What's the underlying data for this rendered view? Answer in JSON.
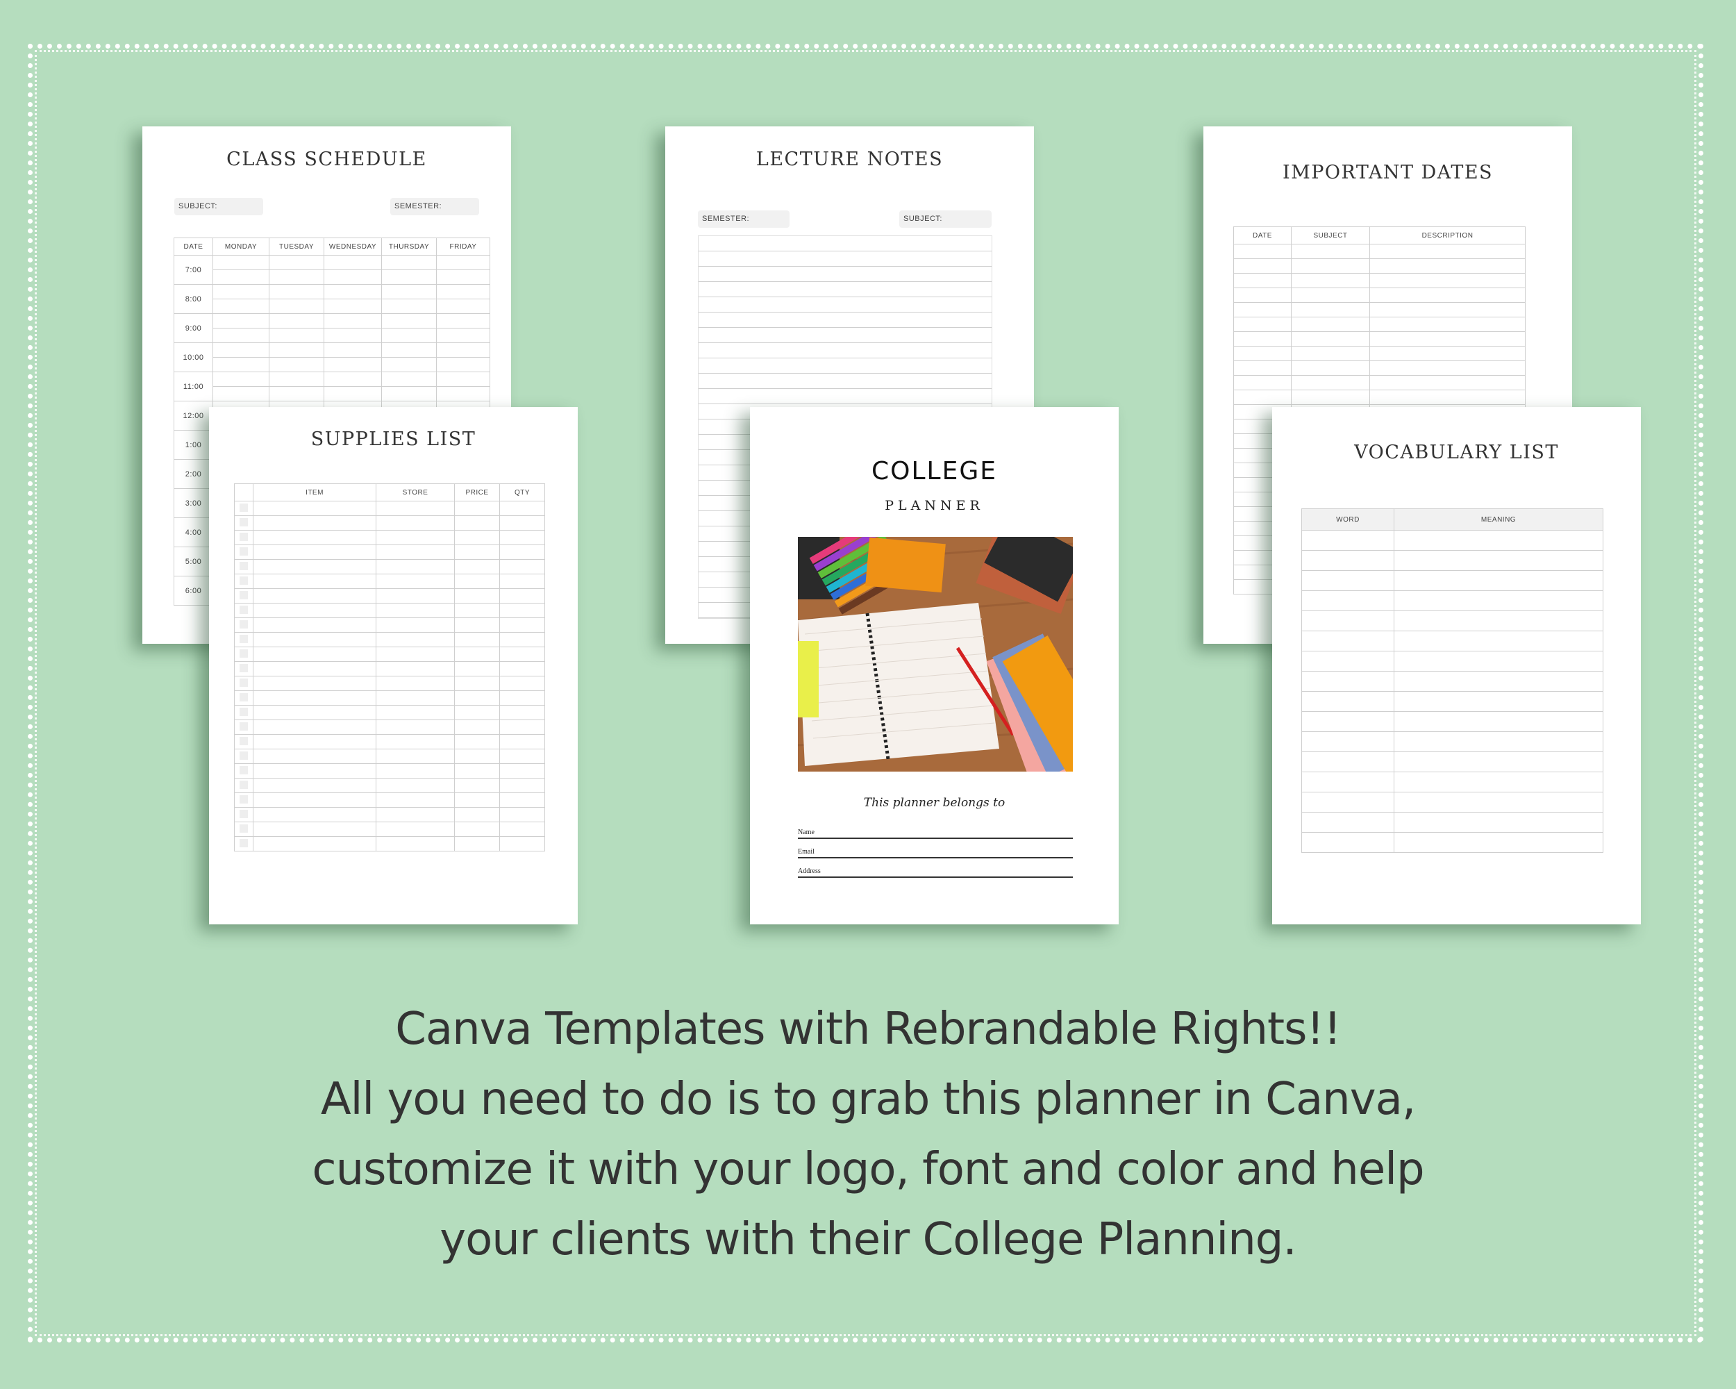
{
  "background_color": "#b5ddbe",
  "pages": {
    "class_schedule": {
      "title": "CLASS SCHEDULE",
      "fields": [
        "SUBJECT:",
        "SEMESTER:"
      ],
      "columns": [
        "DATE",
        "MONDAY",
        "TUESDAY",
        "WEDNESDAY",
        "THURSDAY",
        "FRIDAY"
      ],
      "times": [
        "7:00",
        "8:00",
        "9:00",
        "10:00",
        "11:00",
        "12:00",
        "1:00",
        "2:00",
        "3:00",
        "4:00",
        "5:00",
        "6:00"
      ]
    },
    "lecture_notes": {
      "title": "LECTURE NOTES",
      "fields": [
        "SEMESTER:",
        "SUBJECT:"
      ],
      "line_count": 25
    },
    "important_dates": {
      "title": "IMPORTANT DATES",
      "columns": [
        "DATE",
        "SUBJECT",
        "DESCRIPTION"
      ],
      "row_count": 24
    },
    "supplies_list": {
      "title": "SUPPLIES LIST",
      "columns": [
        "",
        "ITEM",
        "STORE",
        "PRICE",
        "QTY"
      ],
      "row_count": 24
    },
    "cover": {
      "title": "COLLEGE",
      "subtitle": "PLANNER",
      "image_alt": "open spiral notebook with markers, books and red pencil on wooden desk",
      "belongs_to": "This planner belongs to",
      "fields": [
        "Name",
        "Email",
        "Address"
      ]
    },
    "vocabulary_list": {
      "title": "VOCABULARY LIST",
      "columns": [
        "WORD",
        "MEANING"
      ],
      "row_count": 16
    }
  },
  "caption": {
    "lines": [
      "Canva Templates with Rebrandable Rights!!",
      "All you need to do is to grab this planner in Canva,",
      "customize it with your logo, font and color and help",
      "your clients with their College Planning."
    ]
  }
}
